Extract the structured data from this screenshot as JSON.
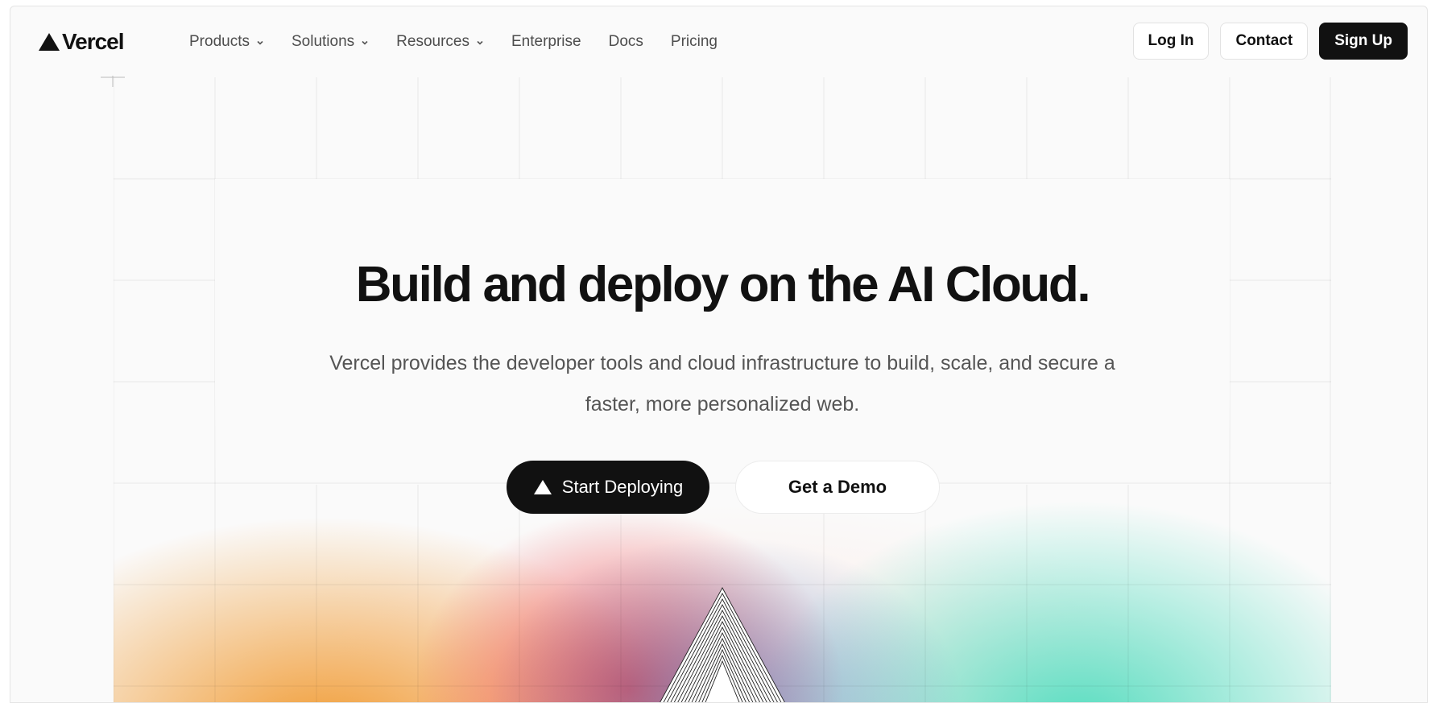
{
  "brand": {
    "name": "Vercel",
    "logo_icon": "triangle-logo-icon"
  },
  "nav": {
    "items": [
      {
        "label": "Products",
        "has_menu": true
      },
      {
        "label": "Solutions",
        "has_menu": true
      },
      {
        "label": "Resources",
        "has_menu": true
      },
      {
        "label": "Enterprise",
        "has_menu": false
      },
      {
        "label": "Docs",
        "has_menu": false
      },
      {
        "label": "Pricing",
        "has_menu": false
      }
    ]
  },
  "actions": {
    "login": "Log In",
    "contact": "Contact",
    "signup": "Sign Up"
  },
  "hero": {
    "title": "Build and deploy on the AI Cloud.",
    "subtitle": "Vercel provides the developer tools and cloud infrastructure to build, scale, and secure a faster, more personalized web.",
    "primary_cta": "Start Deploying",
    "secondary_cta": "Get a Demo"
  },
  "colors": {
    "text": "#111111",
    "muted": "#555555",
    "bg": "#fafafa",
    "gradient_orange": "#f0962a",
    "gradient_red": "#eb3c46",
    "gradient_blue": "#3c78c8",
    "gradient_teal": "#50dcbe"
  }
}
